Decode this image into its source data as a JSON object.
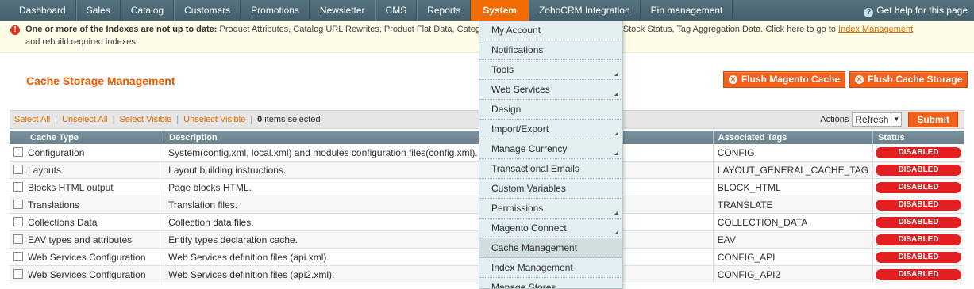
{
  "nav": {
    "items": [
      "Dashboard",
      "Sales",
      "Catalog",
      "Customers",
      "Promotions",
      "Newsletter",
      "CMS",
      "Reports",
      "System",
      "ZohoCRM Integration",
      "Pin management"
    ],
    "active": "System",
    "help": "Get help for this page"
  },
  "notice": {
    "bold": "One or more of the Indexes are not up to date:",
    "text_before_link": " Product Attributes, Catalog URL Rewrites, Product Flat Data, Category Products, Catalog Search Index, Stock Status, Tag Aggregation Data. Click here to go to ",
    "link": "Index Management",
    "text_after_link": "and rebuild required indexes."
  },
  "page": {
    "title": "Cache Storage Management",
    "flush_magento": "Flush Magento Cache",
    "flush_storage": "Flush Cache Storage"
  },
  "gridbar": {
    "select_all": "Select All",
    "unselect_all": "Unselect All",
    "select_visible": "Select Visible",
    "unselect_visible": "Unselect Visible",
    "count": "0",
    "count_suffix": " items selected",
    "actions_label": "Actions",
    "action_selected": "Refresh",
    "submit": "Submit"
  },
  "table": {
    "headers": [
      "Cache Type",
      "Description",
      "Associated Tags",
      "Status"
    ],
    "rows": [
      {
        "type": "Configuration",
        "desc": "System(config.xml, local.xml) and modules configuration files(config.xml).",
        "tags": "CONFIG",
        "status": "DISABLED"
      },
      {
        "type": "Layouts",
        "desc": "Layout building instructions.",
        "tags": "LAYOUT_GENERAL_CACHE_TAG",
        "status": "DISABLED"
      },
      {
        "type": "Blocks HTML output",
        "desc": "Page blocks HTML.",
        "tags": "BLOCK_HTML",
        "status": "DISABLED"
      },
      {
        "type": "Translations",
        "desc": "Translation files.",
        "tags": "TRANSLATE",
        "status": "DISABLED"
      },
      {
        "type": "Collections Data",
        "desc": "Collection data files.",
        "tags": "COLLECTION_DATA",
        "status": "DISABLED"
      },
      {
        "type": "EAV types and attributes",
        "desc": "Entity types declaration cache.",
        "tags": "EAV",
        "status": "DISABLED"
      },
      {
        "type": "Web Services Configuration",
        "desc": "Web Services definition files (api.xml).",
        "tags": "CONFIG_API",
        "status": "DISABLED"
      },
      {
        "type": "Web Services Configuration",
        "desc": "Web Services definition files (api2.xml).",
        "tags": "CONFIG_API2",
        "status": "DISABLED"
      }
    ]
  },
  "system_menu": {
    "items": [
      {
        "label": "My Account",
        "sub": false
      },
      {
        "label": "Notifications",
        "sub": false
      },
      {
        "label": "Tools",
        "sub": true
      },
      {
        "label": "Web Services",
        "sub": true
      },
      {
        "label": "Design",
        "sub": false
      },
      {
        "label": "Import/Export",
        "sub": true
      },
      {
        "label": "Manage Currency",
        "sub": true
      },
      {
        "label": "Transactional Emails",
        "sub": false
      },
      {
        "label": "Custom Variables",
        "sub": false
      },
      {
        "label": "Permissions",
        "sub": true
      },
      {
        "label": "Magento Connect",
        "sub": true
      },
      {
        "label": "Cache Management",
        "sub": false,
        "highlight": true
      },
      {
        "label": "Index Management",
        "sub": false
      },
      {
        "label": "Manage Stores",
        "sub": false
      }
    ]
  },
  "colors": {
    "accent": "#eb5e00",
    "nav_bg": "#4e6b78",
    "status_disabled": "#e41f1f",
    "menu_bg": "#e2eef1"
  }
}
